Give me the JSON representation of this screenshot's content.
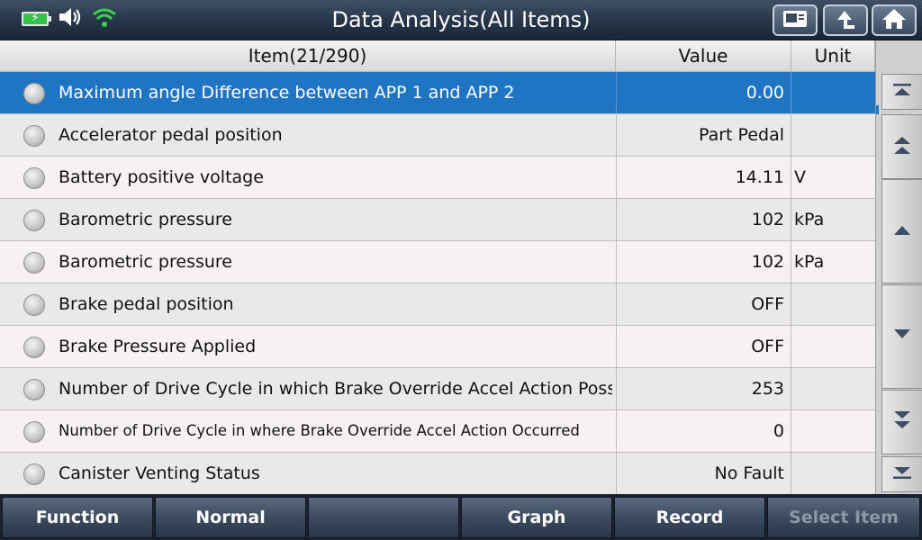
{
  "header": {
    "title": "Data Analysis(All Items)",
    "status_icons": [
      "battery-charging-icon",
      "speaker-icon",
      "wifi-icon"
    ],
    "buttons": [
      "print-screen-icon",
      "back-icon",
      "home-icon"
    ]
  },
  "table": {
    "columns": {
      "item": "Item(21/290)",
      "value": "Value",
      "unit": "Unit"
    },
    "rows": [
      {
        "name": "Maximum angle Difference between APP 1 and APP 2",
        "value": "0.00",
        "unit": "",
        "selected": true
      },
      {
        "name": "Accelerator pedal position",
        "value": "Part Pedal",
        "unit": ""
      },
      {
        "name": "Battery positive voltage",
        "value": "14.11",
        "unit": "V"
      },
      {
        "name": "Barometric pressure",
        "value": "102",
        "unit": "kPa"
      },
      {
        "name": "Barometric pressure",
        "value": "102",
        "unit": "kPa"
      },
      {
        "name": "Brake pedal position",
        "value": "OFF",
        "unit": ""
      },
      {
        "name": "Brake Pressure Applied",
        "value": "OFF",
        "unit": ""
      },
      {
        "name": "Number of Drive Cycle in which Brake Override Accel Action Possible",
        "value": "253",
        "unit": ""
      },
      {
        "name": "Number of Drive Cycle in where Brake Override Accel Action Occurred",
        "value": "0",
        "unit": ""
      },
      {
        "name": "Canister Venting Status",
        "value": "No Fault",
        "unit": ""
      }
    ]
  },
  "scroll": [
    "scroll-top-icon",
    "page-up-icon",
    "line-up-icon",
    "line-down-icon",
    "page-down-icon",
    "scroll-bottom-icon"
  ],
  "footer": {
    "function_label": "Function",
    "normal_label": "Normal",
    "blank_label": "",
    "graph_label": "Graph",
    "record_label": "Record",
    "select_item_label": "Select Item"
  },
  "colors": {
    "selected_row": "#1f74c4",
    "wifi": "#3ad24a",
    "battery": "#36c24a"
  }
}
